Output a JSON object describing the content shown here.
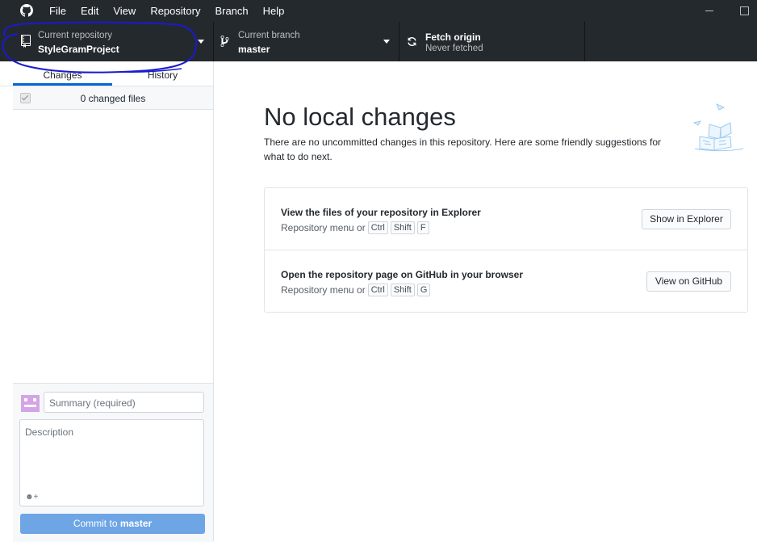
{
  "menu": [
    "File",
    "Edit",
    "View",
    "Repository",
    "Branch",
    "Help"
  ],
  "toolbar": {
    "repo_caption": "Current repository",
    "repo_name": "StyleGramProject",
    "branch_caption": "Current branch",
    "branch_name": "master",
    "fetch_title": "Fetch origin",
    "fetch_status": "Never fetched"
  },
  "sidebar": {
    "tabs": [
      "Changes",
      "History"
    ],
    "active_tab": "Changes",
    "changed_files": "0 changed files",
    "summary_placeholder": "Summary (required)",
    "description_placeholder": "Description",
    "commit_prefix": "Commit to ",
    "commit_branch": "master"
  },
  "main": {
    "title": "No local changes",
    "subtitle": "There are no uncommitted changes in this repository. Here are some friendly suggestions for what to do next.",
    "suggestions": [
      {
        "title": "View the files of your repository in Explorer",
        "hint": "Repository menu or",
        "keys": [
          "Ctrl",
          "Shift",
          "F"
        ],
        "button": "Show in Explorer"
      },
      {
        "title": "Open the repository page on GitHub in your browser",
        "hint": "Repository menu or",
        "keys": [
          "Ctrl",
          "Shift",
          "G"
        ],
        "button": "View on GitHub"
      }
    ]
  },
  "colors": {
    "toolbar_bg": "#24292e",
    "accent": "#0366d6",
    "commit_button": "#6ea5e5",
    "annotation": "#1a1acf"
  },
  "icons": [
    "github-logo-icon",
    "repo-icon",
    "branch-icon",
    "sync-icon",
    "caret-down-icon",
    "checkbox-icon",
    "avatar-icon",
    "add-coauthor-icon"
  ]
}
